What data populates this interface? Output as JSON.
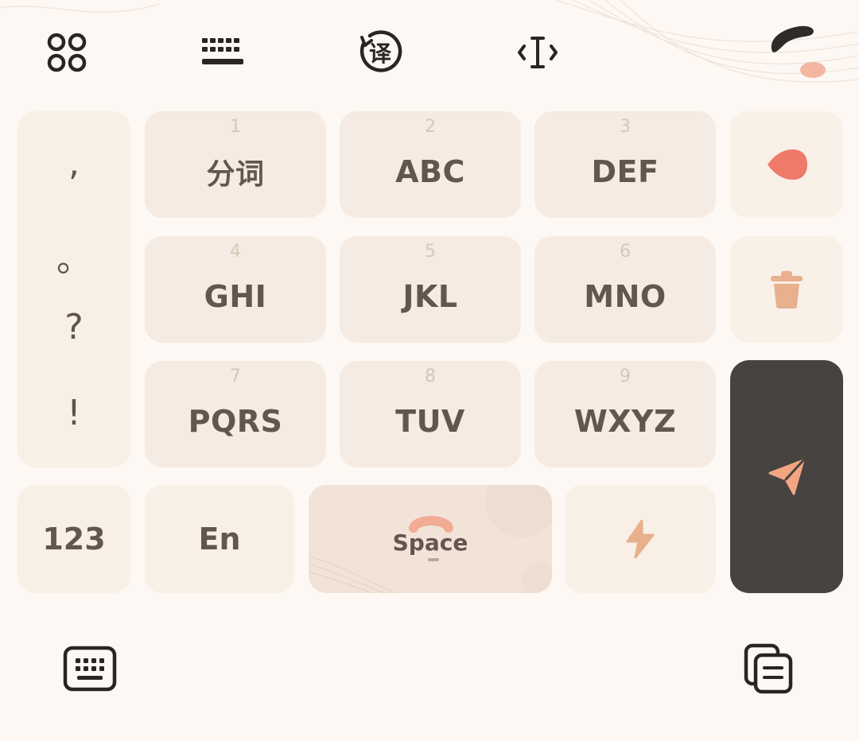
{
  "toolbar": {
    "items": [
      {
        "name": "apps-grid-icon"
      },
      {
        "name": "keyboard-layout-icon"
      },
      {
        "name": "translate-icon",
        "glyph": "译"
      },
      {
        "name": "cursor-edit-icon"
      },
      {
        "name": "skin-theme-icon"
      }
    ]
  },
  "punctuation": [
    ",",
    "。",
    "?",
    "!"
  ],
  "keys": [
    {
      "num": "1",
      "label": "分词"
    },
    {
      "num": "2",
      "label": "ABC"
    },
    {
      "num": "3",
      "label": "DEF"
    },
    {
      "num": "4",
      "label": "GHI"
    },
    {
      "num": "5",
      "label": "JKL"
    },
    {
      "num": "6",
      "label": "MNO"
    },
    {
      "num": "7",
      "label": "PQRS"
    },
    {
      "num": "8",
      "label": "TUV"
    },
    {
      "num": "9",
      "label": "WXYZ"
    }
  ],
  "bottom_row": {
    "numbers_label": "123",
    "lang_label": "En",
    "space_label": "Space"
  },
  "colors": {
    "background": "#fdf8f3",
    "key": "#f5ebe2",
    "text": "#62564e",
    "accent": "#ef7a6a",
    "enter": "#464340",
    "peach": "#e8b08c"
  }
}
